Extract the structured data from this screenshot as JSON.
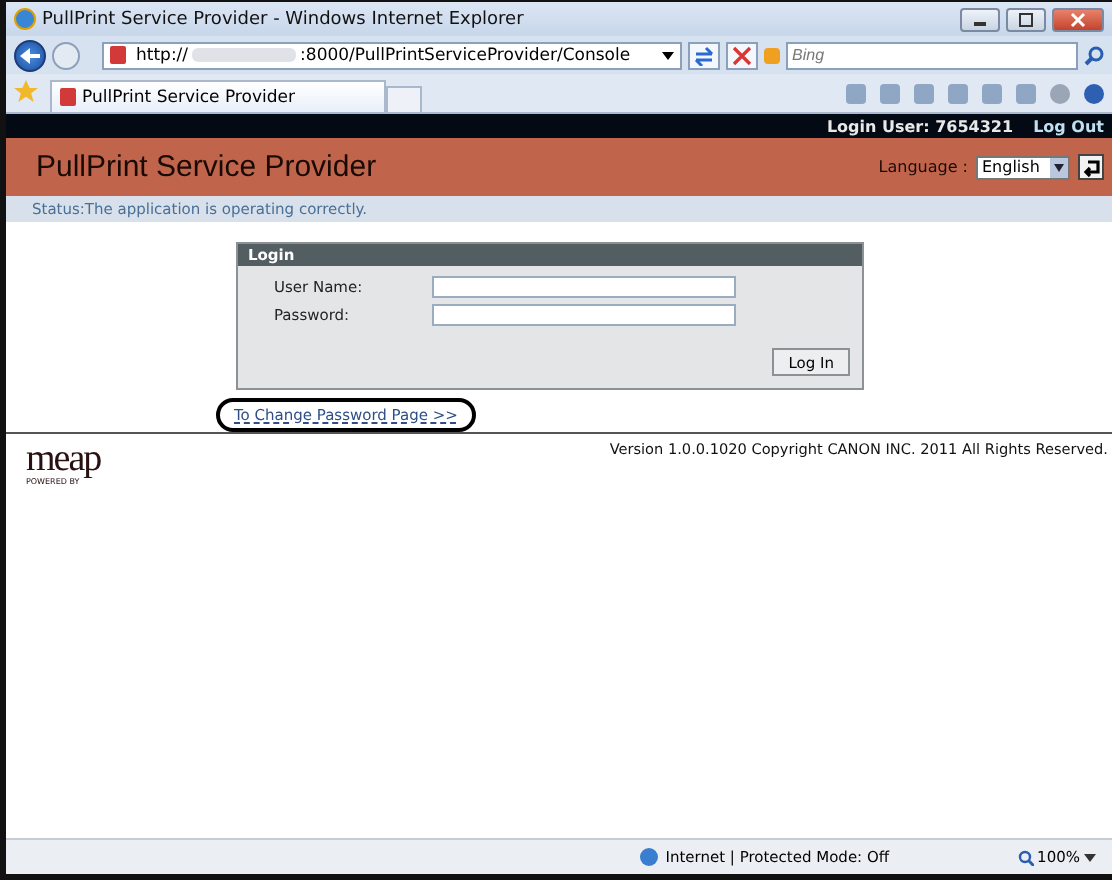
{
  "window": {
    "title": "PullPrint Service Provider - Windows Internet Explorer"
  },
  "address_bar": {
    "url_start": "http://",
    "url_end": ":8000/PullPrintServiceProvider/Console"
  },
  "search": {
    "placeholder": "Bing"
  },
  "tabs": [
    {
      "label": "PullPrint Service Provider",
      "selected": true
    }
  ],
  "header": {
    "login_user": "Login User: 7654321",
    "logout": "Log Out",
    "title": "PullPrint Service Provider",
    "language_label": "Language :",
    "language": "English"
  },
  "status": "Status:The application is operating correctly.",
  "login": {
    "title": "Login",
    "fields": [
      {
        "label": "User Name:"
      },
      {
        "label": "Password:"
      }
    ],
    "button": "Log In"
  },
  "change_password_link": "To Change Password Page >>",
  "footer": {
    "logo": "meap",
    "logo_sub": "POWERED BY",
    "version": "Version 1.0.0.1020 Copyright CANON INC. 2011 All Rights Reserved."
  },
  "status_bar": {
    "zone": "Internet | Protected Mode: Off",
    "zoom": "100%"
  }
}
